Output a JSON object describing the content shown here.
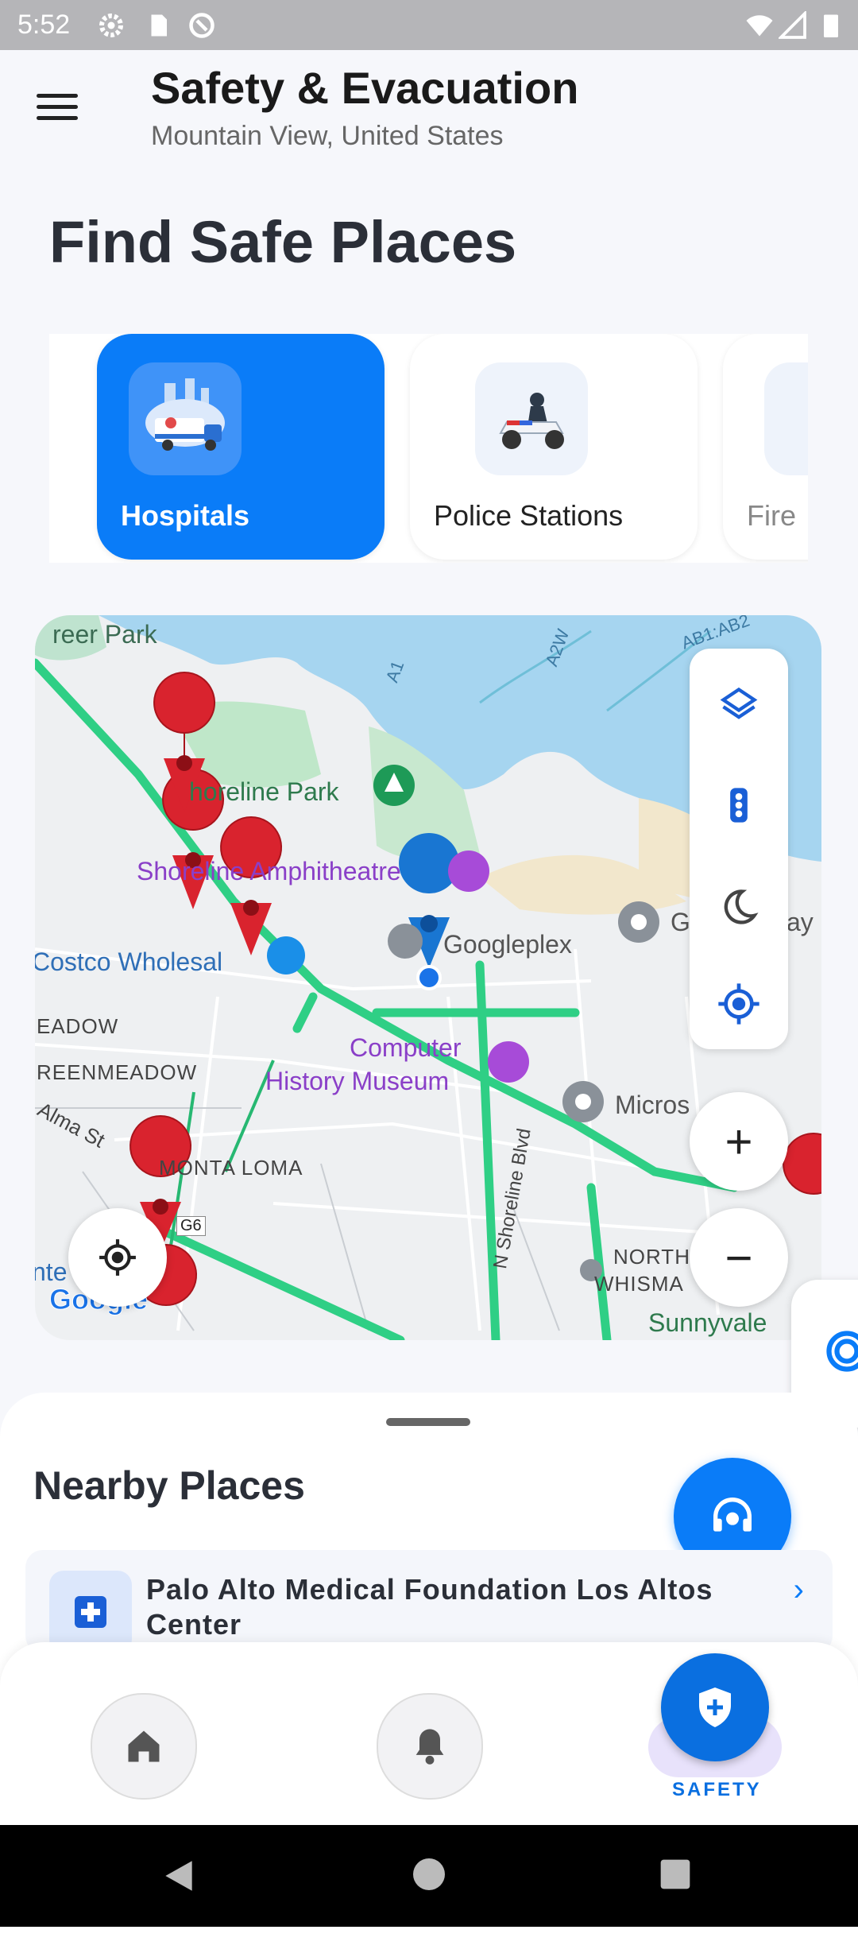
{
  "status_bar": {
    "time": "5:52"
  },
  "header": {
    "title": "Safety & Evacuation",
    "subtitle": "Mountain View, United States"
  },
  "hero_title": "Find Safe Places",
  "categories": [
    {
      "label": "Hospitals",
      "icon": "ambulance-icon",
      "active": true
    },
    {
      "label": "Police Stations",
      "icon": "police-motorcycle-icon",
      "active": false
    },
    {
      "label": "Fire",
      "icon": "fire-station-icon",
      "active": false
    }
  ],
  "map": {
    "labels": {
      "park_top": "reer Park",
      "shoreline_park": "horeline Park",
      "amphitheatre": "Shoreline Amphitheatre",
      "costco": "Costco Wholesal",
      "googleplex": "Googleplex",
      "computer_museum_1": "Computer",
      "computer_museum_2": "History Museum",
      "micros": "Micros",
      "eadow": "EADOW",
      "reenmeadow": "REENMEADOW",
      "alma": "Alma St",
      "monta_loma": "MONTA LOMA",
      "g6": "G6",
      "north": "NORTH",
      "whisma": "WHISMA",
      "sunnyvale": "Sunnyvale",
      "shoreline_blvd": "N Shoreline Blvd",
      "a1": "A1",
      "a2w": "A2W",
      "ab": "AB1:AB2",
      "g_ay": "G",
      "ay": "ay",
      "ente": "nte",
      "google": "Google"
    },
    "controls": [
      "layers-icon",
      "traffic-icon",
      "night-mode-icon",
      "my-location-icon"
    ],
    "zoom_in": "+",
    "zoom_out": "−"
  },
  "nearby": {
    "title": "Nearby Places",
    "places": [
      {
        "name": "Palo Alto Medical Foundation Los Altos Center"
      }
    ]
  },
  "bottom_nav": {
    "items": [
      {
        "icon": "home-icon"
      },
      {
        "icon": "bell-icon"
      },
      {
        "icon": "shield-icon",
        "label": "SAFETY"
      }
    ]
  },
  "colors": {
    "accent": "#0a7cf8",
    "pin_red": "#d9232e",
    "road_green": "#2fcf85",
    "water": "#a6d5f0"
  }
}
